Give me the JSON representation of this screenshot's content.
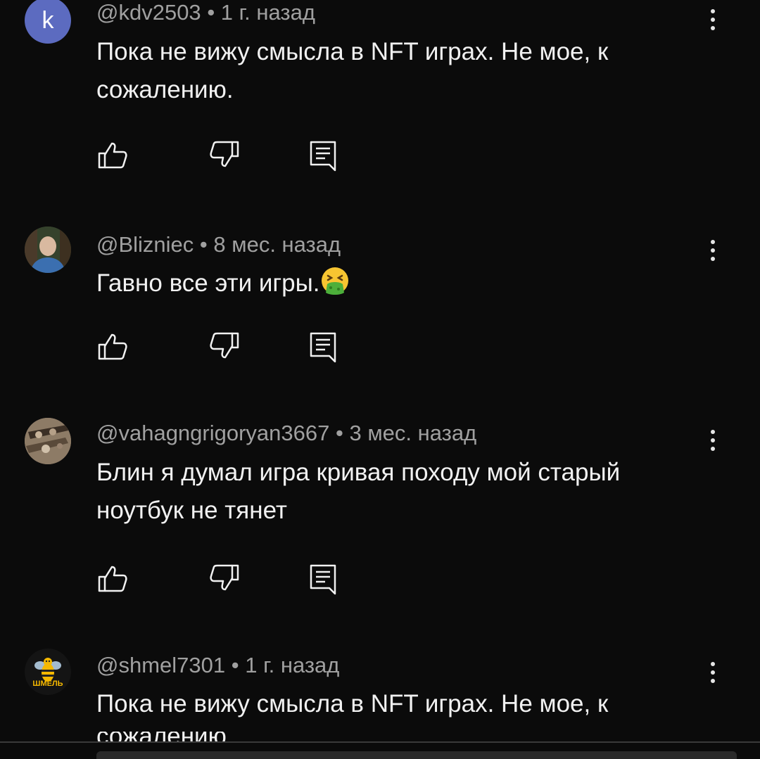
{
  "comments": [
    {
      "handle": "@kdv2503",
      "time": "1 г. назад",
      "avatar_letter": "k",
      "text": "Пока не вижу смысла в NFT играх. Не мое, к сожалению."
    },
    {
      "handle": "@Blizniec",
      "time": "8 мес. назад",
      "text": "Гавно все эти игры."
    },
    {
      "handle": "@vahagngrigoryan3667",
      "time": "3 мес. назад",
      "text": "Блин я думал игра кривая походу мой старый ноутбук не тянет"
    },
    {
      "handle": "@shmel7301",
      "time": "1 г. назад",
      "avatar_text": "ШМЕЛЬ",
      "text": "Пока не вижу смысла в NFT играх. Не мое, к",
      "text_cut": "сожалению."
    }
  ],
  "separator": "•",
  "icons": [
    "like-icon",
    "dislike-icon",
    "reply-icon",
    "more-vert-icon",
    "nauseated-face-emoji"
  ],
  "colors": {
    "background": "#0b0b0b",
    "text": "#f1f1f1",
    "meta": "#a0a0a0",
    "avatar_k": "#5c6bc0"
  }
}
